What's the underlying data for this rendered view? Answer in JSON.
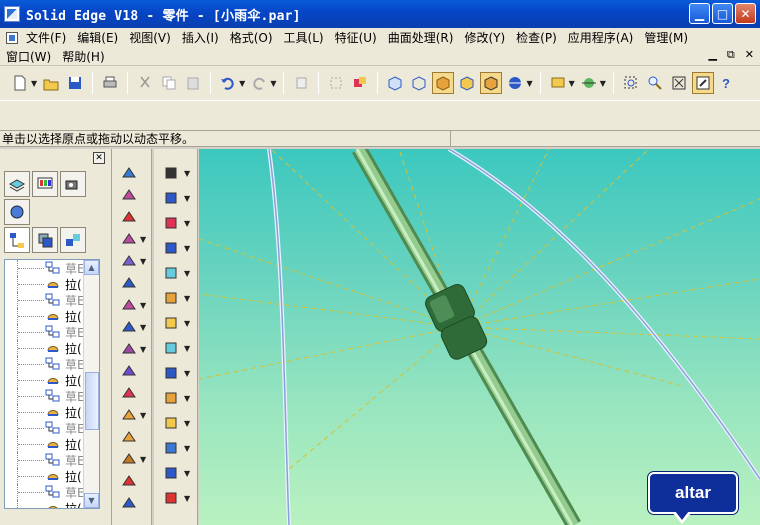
{
  "window": {
    "title": "Solid Edge V18 - 零件 - [小雨伞.par]"
  },
  "menu": {
    "row1": [
      "文件(F)",
      "编辑(E)",
      "视图(V)",
      "插入(I)",
      "格式(O)",
      "工具(L)",
      "特征(U)",
      "曲面处理(R)",
      "修改(Y)",
      "检查(P)",
      "应用程序(A)",
      "管理(M)"
    ],
    "row2": [
      "窗口(W)",
      "帮助(H)"
    ]
  },
  "status": {
    "prompt": "单击以选择原点或拖动以动态平移。"
  },
  "tree": {
    "items": [
      {
        "text": "草E",
        "kind": "sketch"
      },
      {
        "text": "拉(",
        "kind": "protrusion"
      },
      {
        "text": "草E",
        "kind": "sketch"
      },
      {
        "text": "拉(",
        "kind": "protrusion"
      },
      {
        "text": "草E",
        "kind": "sketch"
      },
      {
        "text": "拉(",
        "kind": "protrusion"
      },
      {
        "text": "草E",
        "kind": "sketch"
      },
      {
        "text": "拉(",
        "kind": "protrusion"
      },
      {
        "text": "草E",
        "kind": "sketch"
      },
      {
        "text": "拉(",
        "kind": "protrusion"
      },
      {
        "text": "草E",
        "kind": "sketch"
      },
      {
        "text": "拉(",
        "kind": "protrusion"
      },
      {
        "text": "草E",
        "kind": "sketch"
      },
      {
        "text": "拉(",
        "kind": "protrusion"
      },
      {
        "text": "草E",
        "kind": "sketch"
      },
      {
        "text": "拉(",
        "kind": "protrusion"
      }
    ]
  },
  "badge": {
    "label": "altar"
  },
  "colors": {
    "titlebar": "#0a5bd8",
    "viewport_top": "#3cc8bf",
    "viewport_bottom": "#b9f1c0",
    "shaft": "#6fa86c",
    "rib": "#d8c234"
  }
}
